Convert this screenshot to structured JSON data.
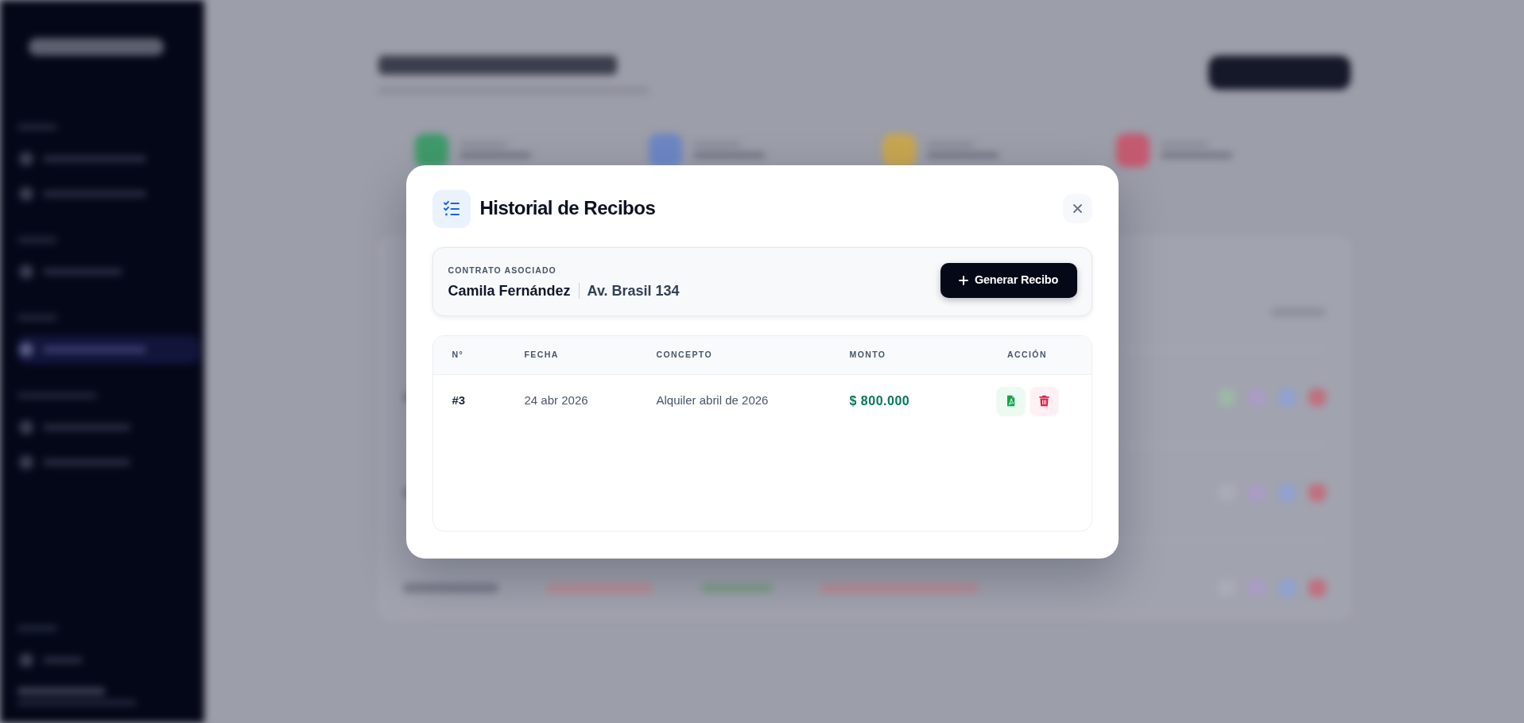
{
  "dialog": {
    "title": "Historial de Recibos",
    "contract": {
      "label": "CONTRATO ASOCIADO",
      "tenant": "Camila Fernández",
      "address": "Av. Brasil 134"
    },
    "generate_button": {
      "label": "Generar Recibo"
    },
    "table": {
      "columns": [
        "N°",
        "FECHA",
        "CONCEPTO",
        "MONTO",
        "ACCIÓN"
      ],
      "rows": [
        {
          "number": "#3",
          "date": "24 abr 2026",
          "concept": "Alquiler abril de 2026",
          "amount": "$ 800.000",
          "actions": [
            {
              "kind": "pdf"
            },
            {
              "kind": "delete"
            }
          ]
        }
      ]
    }
  }
}
